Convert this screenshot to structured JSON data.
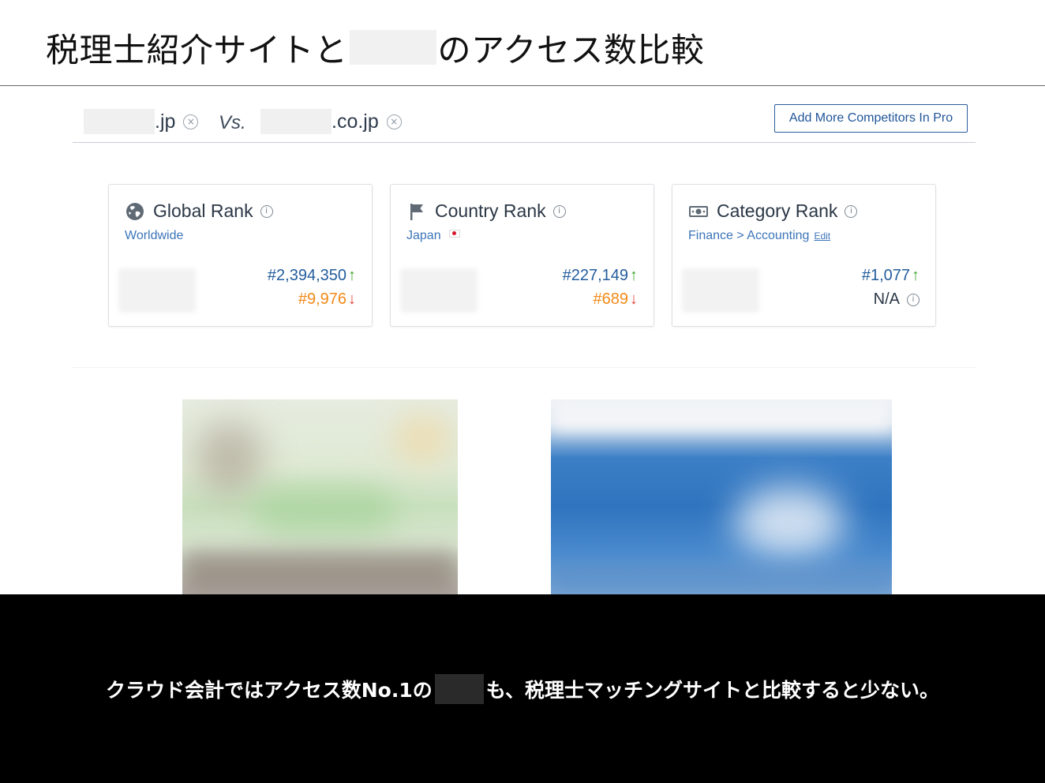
{
  "slide": {
    "title_part1": "税理士紹介サイトと",
    "title_part2": "のアクセス数比較",
    "caption_part1": "クラウド会計ではアクセス数No.1の",
    "caption_part2": "も、税理士マッチングサイトと比較すると少ない。"
  },
  "compare": {
    "site_a_suffix": ".jp",
    "vs_label": "Vs.",
    "site_b_suffix": ".co.jp",
    "remove_glyph": "×",
    "add_button": "Add More Competitors In Pro"
  },
  "cards": {
    "global": {
      "title": "Global Rank",
      "subtitle": "Worldwide",
      "icon": "globe-icon",
      "rank_a": "#2,394,350",
      "rank_b": "#9,976",
      "trend_a": "↑",
      "trend_b": "↓"
    },
    "country": {
      "title": "Country Rank",
      "subtitle": "Japan",
      "icon": "flag-icon",
      "rank_a": "#227,149",
      "rank_b": "#689",
      "trend_a": "↑",
      "trend_b": "↓"
    },
    "category": {
      "title": "Category Rank",
      "subtitle": "Finance > Accounting",
      "edit_link": "Edit",
      "icon": "money-icon",
      "rank_a": "#1,077",
      "rank_b": "N/A",
      "trend_a": "↑"
    },
    "info_glyph": "i"
  },
  "colors": {
    "link_blue": "#3c75b8",
    "rank_blue": "#235d9d",
    "rank_orange": "#f28a18",
    "arrow_up_green": "#3fa62c",
    "arrow_down_red": "#e5443b",
    "caption_band": "#000000"
  }
}
